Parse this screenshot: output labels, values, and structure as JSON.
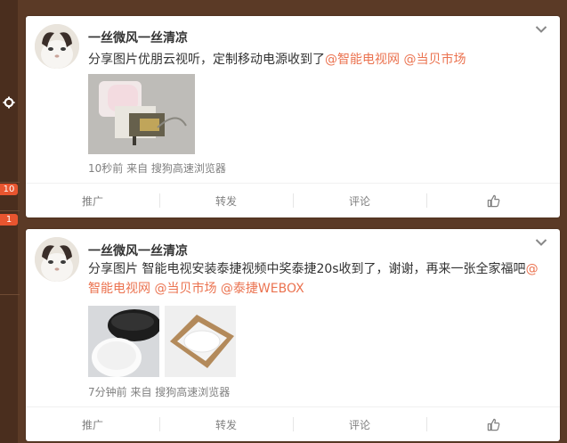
{
  "sidebar": {
    "badge_count_a": "10",
    "badge_count_b": "1",
    "icon_settings": "gear-icon"
  },
  "posts": [
    {
      "user": "一丝微风一丝清凉",
      "text_plain": "分享图片优朋云视听，定制移动电源收到了",
      "mentions": [
        "@智能电视网",
        "@当贝市场"
      ],
      "meta": "10秒前 来自 搜狗高速浏览器"
    },
    {
      "user": "一丝微风一丝清凉",
      "text_plain": "分享图片 智能电视安装泰捷视频中奖泰捷20s收到了，谢谢，再来一张全家福吧",
      "mentions": [
        "@智能电视网",
        "@当贝市场",
        "@泰捷WEBOX"
      ],
      "meta": "7分钟前 来自 搜狗高速浏览器"
    }
  ],
  "actions": {
    "promote": "推广",
    "repost": "转发",
    "comment": "评论"
  },
  "colors": {
    "mention": "#eb7350",
    "background": "#5b3a26",
    "badge": "#e8552f"
  }
}
